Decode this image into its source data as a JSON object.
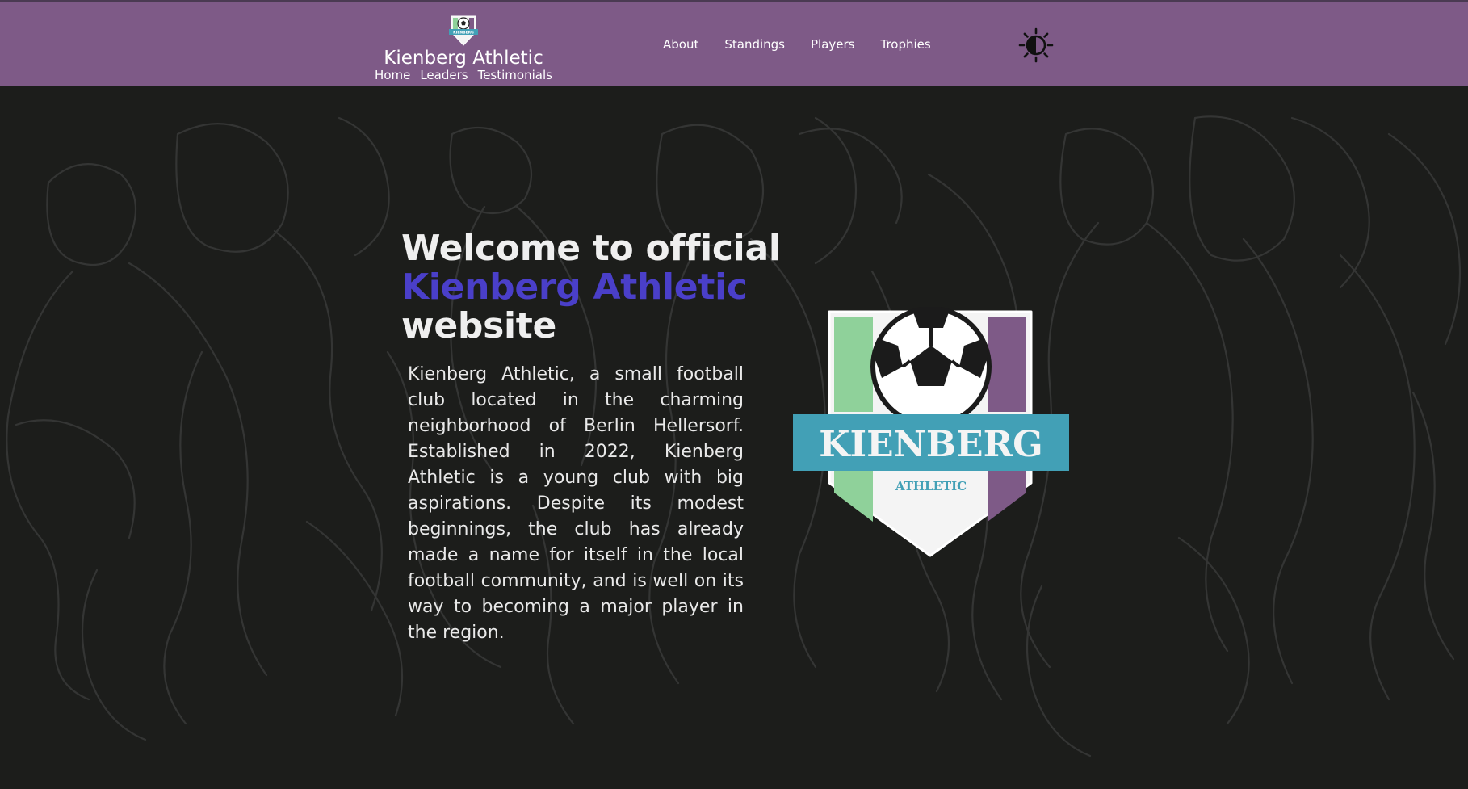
{
  "header": {
    "brand_name": "Kienberg Athletic",
    "logo_text": "KIENBERG",
    "subnav": [
      {
        "label": "Home"
      },
      {
        "label": "Leaders"
      },
      {
        "label": "Testimonials"
      }
    ],
    "mainnav": [
      {
        "label": "About"
      },
      {
        "label": "Standings"
      },
      {
        "label": "Players"
      },
      {
        "label": "Trophies"
      }
    ],
    "theme_toggle_icon": "contrast-sun-icon"
  },
  "hero": {
    "title_line1": "Welcome to official",
    "title_accent": "Kienberg Athletic",
    "title_line3": "website",
    "description": "Kienberg Athletic, a small football club located in the charming neighborhood of Berlin Hellersorf. Established in 2022, Kienberg Athletic is a young club with big aspirations. Despite its modest beginnings, the club has already made a name for itself in the local football community, and is well on its way to becoming a major player in the region."
  },
  "crest": {
    "banner_text": "KIENBERG",
    "sub_text": "ATHLETIC"
  },
  "colors": {
    "navbar": "#7e5a87",
    "background": "#1c1d1b",
    "accent": "#4a3fc9",
    "crest_green": "#8fd19a",
    "crest_purple": "#7e5a87",
    "crest_banner": "#42a0b6"
  }
}
